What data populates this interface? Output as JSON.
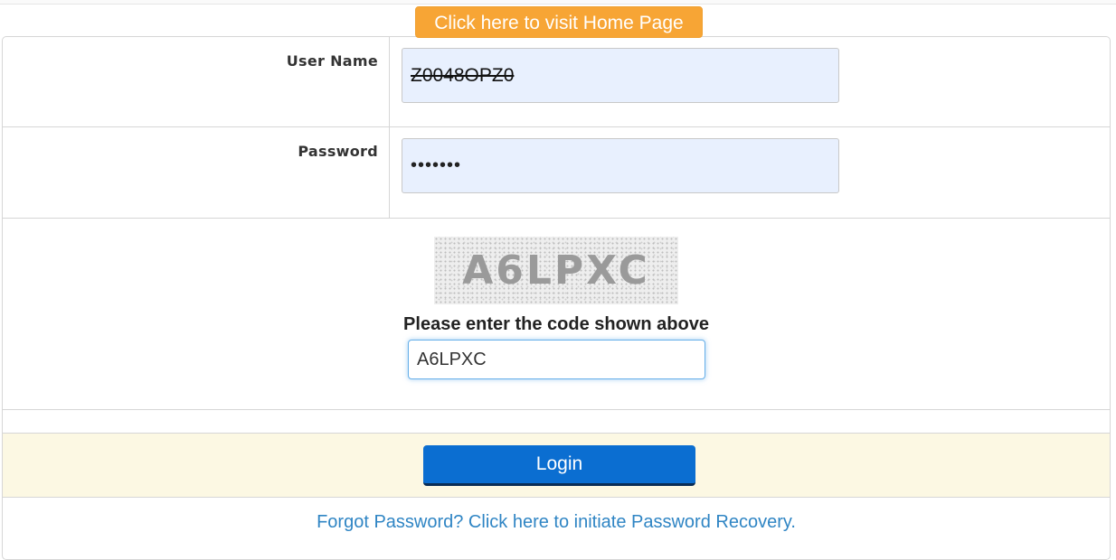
{
  "header": {
    "home_button_label": "Click here to visit Home Page"
  },
  "login_form": {
    "username": {
      "label": "User Name",
      "value": "Z0048OPZ0"
    },
    "password": {
      "label": "Password",
      "masked_value": "•••••••"
    },
    "captcha": {
      "image_text": "A6LPXC",
      "prompt": "Please enter the code shown above",
      "input_value": "A6LPXC"
    },
    "login_button_label": "Login",
    "forgot_password_link": "Forgot Password? Click here to initiate Password Recovery."
  },
  "colors": {
    "home_button": "#f7a535",
    "login_button": "#0b6ed1",
    "login_row_background": "#fcf8e3",
    "link": "#2f85c4",
    "input_fill": "#e8f0fe"
  }
}
